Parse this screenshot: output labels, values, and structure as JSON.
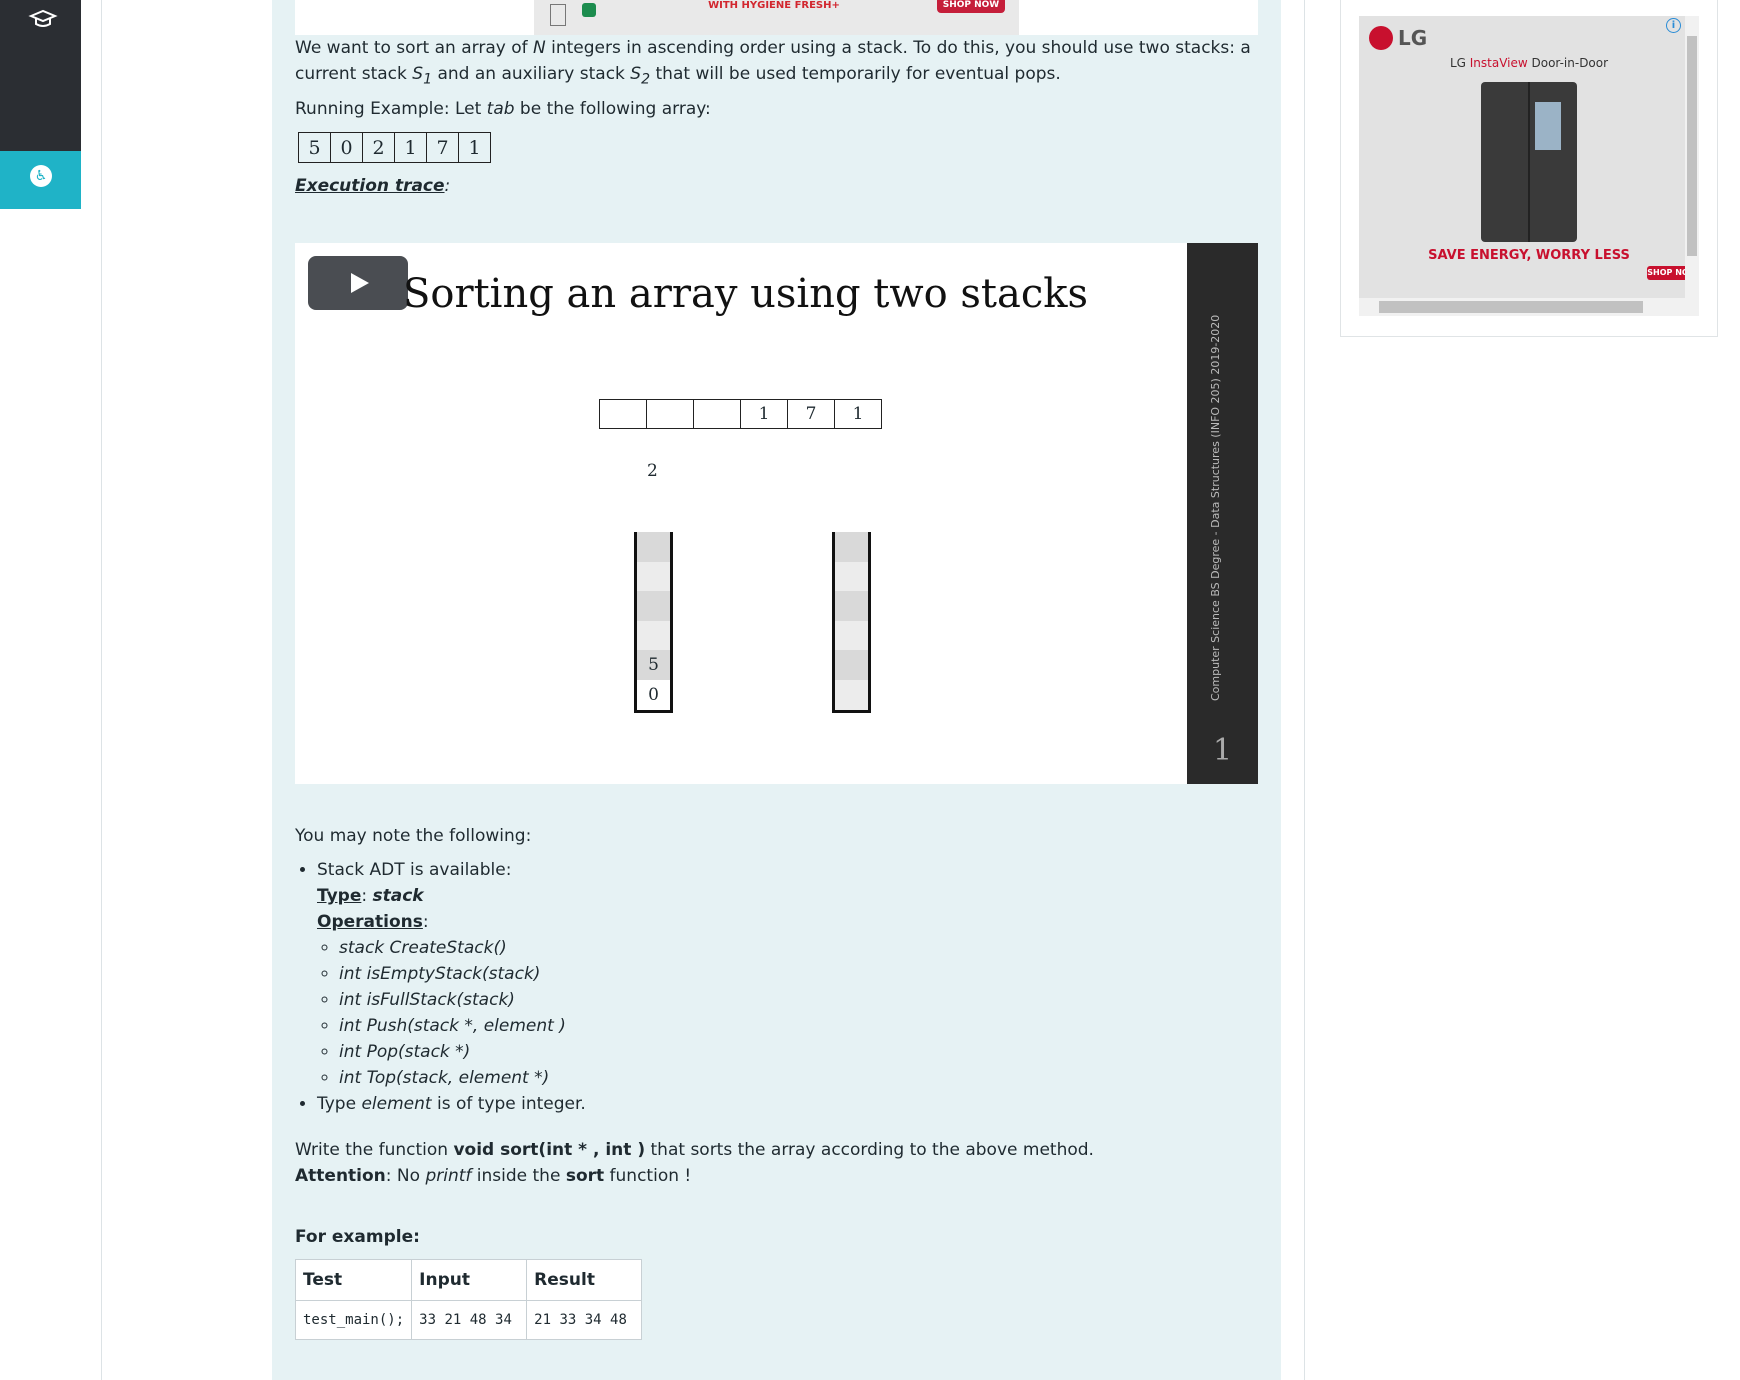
{
  "top_ad": {
    "headline": "WITH HYGIENE FRESH+",
    "shop_label": "SHOP NOW"
  },
  "intro": {
    "sentence_a": "We want to sort an array of ",
    "var_n": "N",
    "sentence_b": " integers in ascending order using a stack. To do this, you should use two stacks: a current stack ",
    "s1": "S",
    "s1_sub": "1",
    "sentence_c": " and an auxiliary stack ",
    "s2": "S",
    "s2_sub": "2",
    "sentence_d": " that will be used temporarily for eventual pops."
  },
  "running_example": {
    "prefix": "Running Example: Let ",
    "var": "tab",
    "suffix": " be the following array:",
    "array": [
      "5",
      "0",
      "2",
      "1",
      "7",
      "1"
    ]
  },
  "execution_trace": {
    "label": "Execution trace",
    "colon": ":"
  },
  "video": {
    "title": "Sorting an array using two stacks",
    "array_cells": [
      "",
      "",
      "",
      "1",
      "7",
      "1"
    ],
    "floating_value": "2",
    "stack1_values": [
      "5",
      "0"
    ],
    "side_text": "Computer Science BS Degree - Data Structures (INFO 205) 2019-2020",
    "slide_number": "1"
  },
  "notes": {
    "intro": "You may note the following:",
    "adt_available": "Stack ADT is available:",
    "type_label": "Type",
    "type_value": "stack",
    "operations_label": "Operations",
    "operations": [
      "stack CreateStack()",
      "int isEmptyStack(stack)",
      "int isFullStack(stack)",
      "int Push(stack *, element )",
      "int Pop(stack *)",
      "int Top(stack, element *)"
    ],
    "element_a": "Type ",
    "element_var": "element",
    "element_b": " is of type integer."
  },
  "task": {
    "write_a": "Write the function ",
    "write_fn": "void sort(int * , int )",
    "write_b": " that sorts the array according to the above method.",
    "attention_label": "Attention",
    "attention_a": ": No ",
    "attention_printf": "printf",
    "attention_b": " inside the ",
    "attention_sort": "sort",
    "attention_c": " function !"
  },
  "example": {
    "label": "For example:",
    "headers": [
      "Test",
      "Input",
      "Result"
    ],
    "rows": [
      [
        "test_main();",
        "33 21 48 34",
        "21 33 34 48"
      ]
    ]
  },
  "side_ad": {
    "brand": "LG",
    "product_a": "LG ",
    "product_b": "InstaView",
    "product_c": " Door-in-Door",
    "tagline": "SAVE ENERGY, WORRY LESS",
    "shop_label": "SHOP NO",
    "info": "i"
  }
}
